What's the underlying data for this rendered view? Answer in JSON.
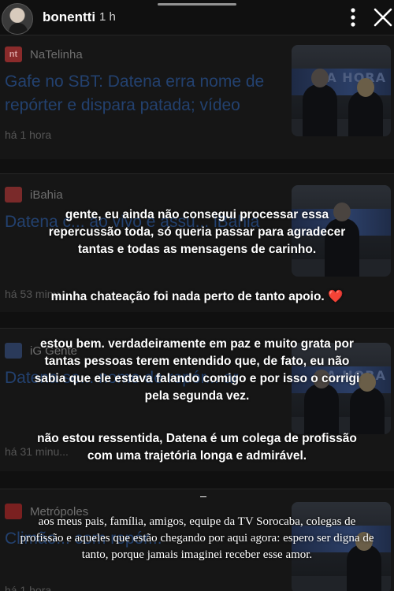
{
  "story": {
    "username": "bonentti",
    "age": "1 h"
  },
  "feed": {
    "cards": [
      {
        "source": "NaTelinha",
        "logo_text": "nt",
        "logo_color": "#8a2b2b",
        "headline": "Gafe no SBT: Datena erra nome de repórter e dispara patada; vídeo",
        "time": "há 1 hora",
        "thumb_text": "NA HORA"
      },
      {
        "source": "iBahia",
        "logo_text": "",
        "logo_color": "#7a2a2a",
        "headline": "Datena c... ao vivo e assu... iBahia",
        "time": "há 53 minu...",
        "thumb_text": ""
      },
      {
        "source": "iG Gente",
        "logo_text": "",
        "logo_color": "#2a3a5a",
        "headline": "Datena se... nome de repór... ar",
        "time": "há 31 minu...",
        "thumb_text": "NA HORA"
      },
      {
        "source": "Metrópoles",
        "logo_text": "",
        "logo_color": "#7a2020",
        "headline": "Climão... com repór...",
        "time": "há 1 hora",
        "thumb_text": ""
      }
    ]
  },
  "caption": {
    "p1": "gente, eu ainda não consegui processar essa repercussão toda, só queria passar para agradecer tantas e todas as mensagens de carinho.",
    "p2": "minha chateação foi nada perto de tanto apoio. ❤️",
    "p3": "estou bem. verdadeiramente em paz e muito grata por tantas pessoas terem entendido que, de fato, eu não sabia que ele estava falando comigo e por isso o corrigi pela segunda vez.",
    "p4": "não estou ressentida, Datena é um colega de profissão com uma trajetória longa e admirável.",
    "closing": "aos meus pais, família, amigos, equipe da TV Sorocaba, colegas de profissão e aqueles que estão chegando por aqui agora: espero ser digna de tanto, porque jamais imaginei receber esse amor."
  }
}
